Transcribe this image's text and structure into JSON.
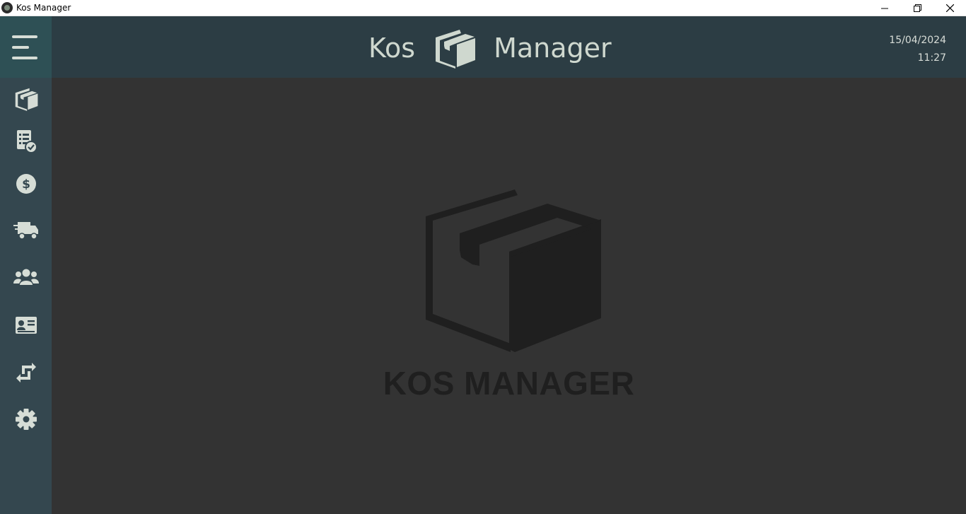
{
  "window": {
    "title": "Kos Manager"
  },
  "header": {
    "brand_left": "Kos",
    "brand_right": "Manager",
    "date": "15/04/2024",
    "time": "11:27"
  },
  "sidebar": {
    "items": [
      {
        "name": "products",
        "icon": "box-icon"
      },
      {
        "name": "orders",
        "icon": "checklist-icon"
      },
      {
        "name": "finance",
        "icon": "dollar-icon"
      },
      {
        "name": "delivery",
        "icon": "truck-icon"
      },
      {
        "name": "clients",
        "icon": "users-icon"
      },
      {
        "name": "employees",
        "icon": "id-card-icon"
      },
      {
        "name": "transfers",
        "icon": "exchange-icon"
      },
      {
        "name": "settings",
        "icon": "gear-icon"
      }
    ]
  },
  "main": {
    "logo_text": "KOS MANAGER"
  },
  "colors": {
    "sidebar": "#34474f",
    "menu_button": "#2e5055",
    "header": "#2c3d44",
    "content": "#333333",
    "icon": "#d6ddd6",
    "logo": "#1f1f1f"
  }
}
